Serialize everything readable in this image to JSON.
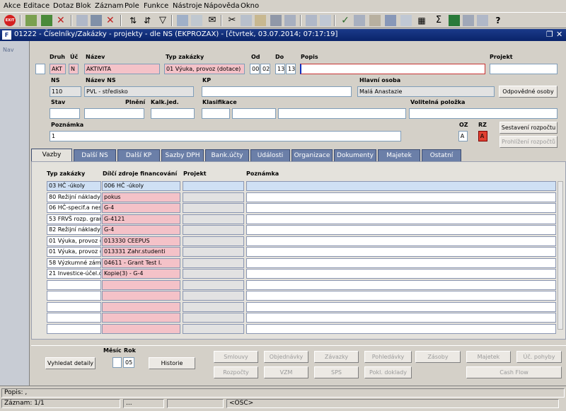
{
  "menu": [
    "Akce",
    "Editace",
    "Dotaz",
    "Blok",
    "Záznam",
    "Pole",
    "Funkce",
    "Nástroje",
    "Nápověda",
    "Okno"
  ],
  "toolbar": {
    "exit_label": "EXIT"
  },
  "window": {
    "title": "01222 - Číselníky/Zakázky - projekty - dle NS (EKPROZAX) - [čtvrtek, 03.07.2014; 07:17:19]"
  },
  "nav": {
    "label": "Nav"
  },
  "form": {
    "labels": {
      "druh": "Druh",
      "uc": "Úč",
      "nazev": "Název",
      "typ": "Typ zakázky",
      "od": "Od",
      "do": "Do",
      "popis": "Popis",
      "projekt": "Projekt",
      "ns": "NS",
      "nazev_ns": "Název NS",
      "kp": "KP",
      "hlavni_osoba": "Hlavní osoba",
      "stav": "Stav",
      "plneni": "Plnění",
      "kalk": "Kalk.jed.",
      "klasifikace": "Klasifikace",
      "volitelna": "Volitelná položka",
      "poznamka": "Poznámka",
      "oz": "OZ",
      "rz": "RZ"
    },
    "values": {
      "druh": "AKT",
      "uc": "N",
      "nazev": "AKTIVITA",
      "typ": "01 Výuka, provoz (dotace)",
      "od1": "00",
      "od2": "02",
      "do1": "13",
      "do2": "13",
      "popis": "",
      "projekt": "",
      "ns": "110",
      "nazev_ns": "PVL - středisko",
      "kp": "",
      "hlavni_osoba": "Malá Anastazie",
      "stav": "",
      "plneni": "",
      "kalk": "",
      "klas1": "",
      "klas2": "",
      "klas3": "",
      "volitelna": "",
      "poznamka": "1",
      "oz": "A",
      "rz": "A"
    },
    "buttons": {
      "odpovedne": "Odpovědné osoby",
      "sestaveni": "Sestavení rozpočtu",
      "prohlizeni": "Prohlížení rozpočtů"
    }
  },
  "tabs": [
    "Vazby",
    "Další NS",
    "Další KP",
    "Sazby DPH",
    "Bank.účty",
    "Události",
    "Organizace",
    "Dokumenty",
    "Majetek",
    "Ostatní"
  ],
  "grid": {
    "headers": [
      "Typ zakázky",
      "Dílčí zdroje financování",
      "Projekt",
      "Poznámka"
    ],
    "rows": [
      [
        "03 HČ -úkoly",
        "006 HČ -úkoly",
        "",
        ""
      ],
      [
        "80 Režijní náklady",
        "pokus",
        "",
        ""
      ],
      [
        "06 HČ-specif.a nes",
        "G-4",
        "",
        ""
      ],
      [
        "53 FRVŠ rozp. gran",
        "G-4121",
        "",
        ""
      ],
      [
        "82 Režijní náklady",
        "G-4",
        "",
        ""
      ],
      [
        "01 Výuka, provoz (",
        "013330 CEEPUS",
        "",
        ""
      ],
      [
        "01 Výuka, provoz (",
        "013331 Zahr.studenti",
        "",
        ""
      ],
      [
        "58 Výzkumné zám",
        "04611 - Grant Test I.",
        "",
        ""
      ],
      [
        "21 Investice-účel.d",
        "Kopie(3) - G-4",
        "",
        ""
      ],
      [
        "",
        "",
        "",
        ""
      ],
      [
        "",
        "",
        "",
        ""
      ],
      [
        "",
        "",
        "",
        ""
      ],
      [
        "",
        "",
        "",
        ""
      ],
      [
        "",
        "",
        "",
        ""
      ]
    ]
  },
  "bottom": {
    "vyhledat": "Vyhledat detaily",
    "mesic_label": "Měsíc",
    "rok_label": "Rok",
    "mesic": "",
    "rok": "05",
    "historie": "Historie",
    "buttons_row1": [
      "Smlouvy",
      "Objednávky",
      "Závazky",
      "Pohledávky",
      "Zásoby",
      "Majetek",
      "Úč. pohyby"
    ],
    "buttons_row2": [
      "Rozpočty",
      "VZM",
      "SPS",
      "Pokl. doklady",
      "Cash Flow"
    ]
  },
  "status": {
    "popis": "Popis: ,",
    "zaznam": "Záznam: 1/1",
    "dots": "...",
    "mode": "<OSC>"
  }
}
